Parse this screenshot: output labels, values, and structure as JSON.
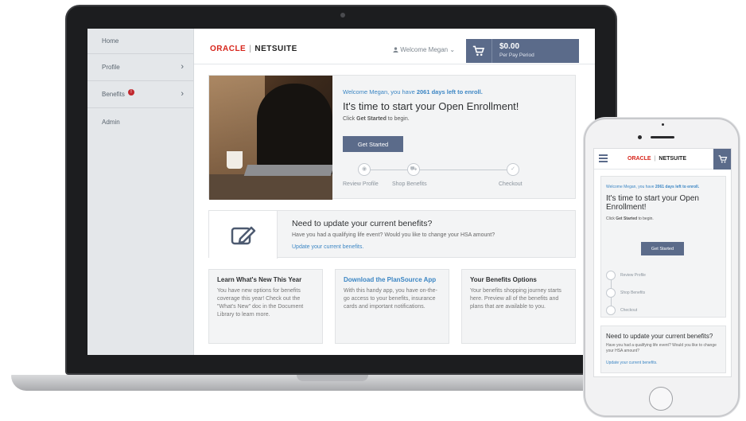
{
  "laptop": {
    "sidebar": {
      "items": [
        {
          "label": "Home"
        },
        {
          "label": "Profile",
          "chevron": "›"
        },
        {
          "label": "Benefits",
          "badge": "!",
          "chevron": "›"
        },
        {
          "label": "Admin"
        }
      ]
    },
    "header": {
      "brand_oracle": "ORACLE",
      "brand_sep": "|",
      "brand_netsuite": "NETSUITE",
      "welcome": "Welcome Megan",
      "welcome_caret": "⌄",
      "cart_amount": "$0.00",
      "cart_period": "Per Pay Period",
      "cart_icon": "cart-icon",
      "user_icon": "user-icon"
    },
    "hero": {
      "welcome_prefix": "Welcome Megan, you have ",
      "welcome_days": "2061 days left to enroll.",
      "title": "It's time to start your Open Enrollment!",
      "sub_prefix": "Click ",
      "sub_bold": "Get Started",
      "sub_suffix": " to begin.",
      "button": "Get Started",
      "steps": [
        "Review Profile",
        "Shop Benefits",
        "Checkout"
      ]
    },
    "update": {
      "title": "Need to update your current benefits?",
      "subtitle": "Have you had a qualifying life event? Would you like to change your HSA amount?",
      "link": "Update your current benefits.",
      "icon": "edit-icon"
    },
    "cards": [
      {
        "title": "Learn What's New This Year",
        "body": "You have new options for benefits coverage this year! Check out the \"What's New\" doc in the Document Library to learn more."
      },
      {
        "title": "Download the PlanSource App",
        "body": "With this handy app, you have on-the-go access to your benefits, insurance cards and important notifications."
      },
      {
        "title": "Your Benefits Options",
        "body": "Your benefits shopping journey starts here. Preview all of the benefits and plans that are available to you."
      }
    ]
  },
  "phone": {
    "brand_oracle": "ORACLE",
    "brand_sep": "|",
    "brand_netsuite": "NETSUITE",
    "welcome_prefix": "Welcome Megan, you have ",
    "welcome_days": "2061 days left to enroll.",
    "title": "It's time to start your Open Enrollment!",
    "sub_prefix": "Click ",
    "sub_bold": "Get Started",
    "sub_suffix": " to begin.",
    "button": "Get Started",
    "steps": [
      "Review Profile",
      "Shop Benefits",
      "Checkout"
    ],
    "update_title": "Need to update your current benefits?",
    "update_sub": "Have you had a qualifying life event? Would you like to change your HSA amount?",
    "update_link": "Update your current benefits."
  },
  "colors": {
    "accent": "#5b6b8a",
    "link": "#3c86c4",
    "oracle_red": "#d7251b",
    "badge_red": "#c0272d"
  }
}
